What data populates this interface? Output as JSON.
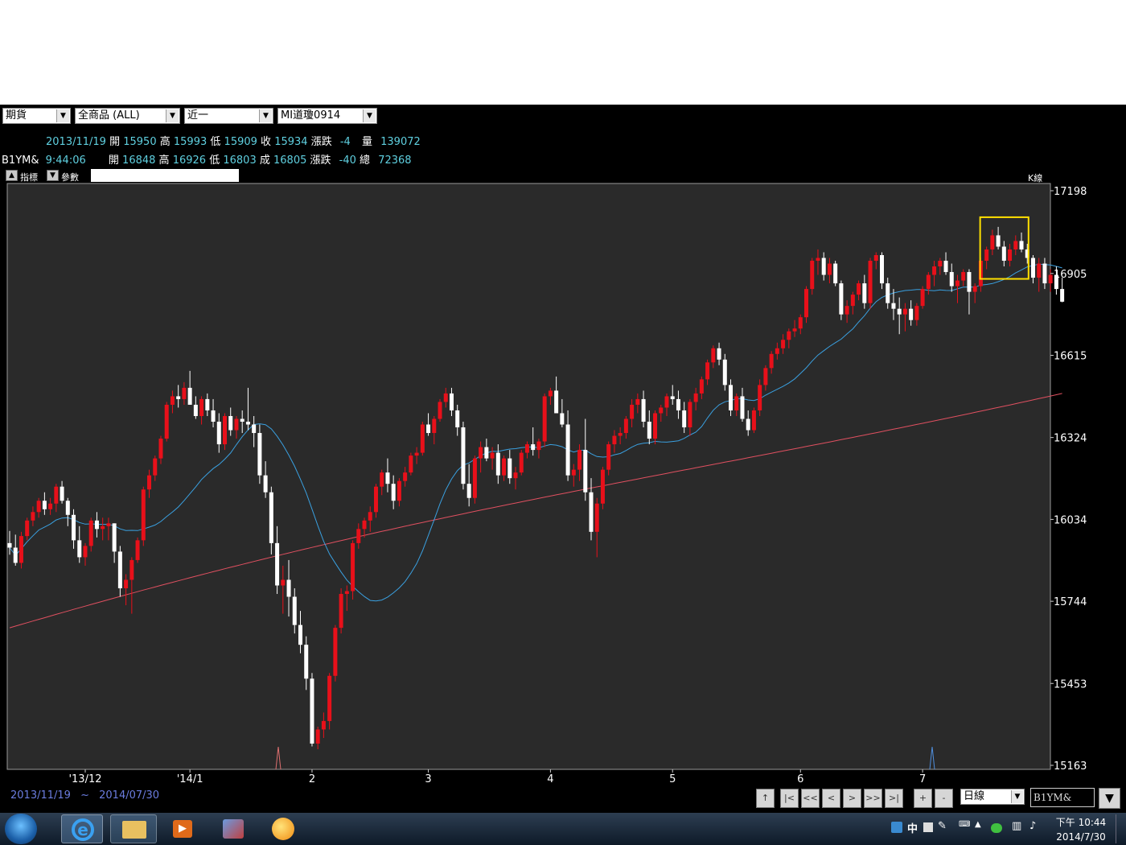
{
  "toolbar": {
    "market": "期貨",
    "product": "全商品        (ALL)",
    "period_sel": "近一",
    "symbol_sel": "MI道瓊0914"
  },
  "quote1": {
    "date": "2013/11/19",
    "open_lbl": "開",
    "open": "15950",
    "high_lbl": "高",
    "high": "15993",
    "low_lbl": "低",
    "low": "15909",
    "close_lbl": "收",
    "close": "15934",
    "chg_lbl": "漲跌",
    "chg": "-4",
    "vol_lbl": "量",
    "vol": "139072"
  },
  "quote2": {
    "sym": "B1YM&",
    "time": "9:44:06",
    "open_lbl": "開",
    "open": "16848",
    "high_lbl": "高",
    "high": "16926",
    "low_lbl": "低",
    "low": "16803",
    "last_lbl": "成",
    "last": "16805",
    "chg_lbl": "漲跌",
    "chg": "-40",
    "tot_lbl": "總",
    "tot": "72368"
  },
  "panel": {
    "indicator": "指標",
    "params": "參數",
    "klabel": "K線"
  },
  "bottom": {
    "range_start": "2013/11/19",
    "range_sep": "~",
    "range_end": "2014/07/30",
    "period": "日線",
    "symbol": "B1YM&"
  },
  "nav": [
    "↑",
    "|<",
    "<<",
    "<",
    ">",
    ">>",
    ">|",
    "+",
    "-"
  ],
  "clock": {
    "time": "下午 10:44",
    "date": "2014/7/30"
  },
  "tray": {
    "ime": "中"
  },
  "colors": {
    "up": "#e8101a",
    "down": "#ffffff",
    "ma_short": "#3aa0e0",
    "ma_long": "#e05060",
    "highlight": "#ffe000",
    "plot_bg": "#2a2a2a"
  },
  "chart_data": {
    "type": "candlestick",
    "ylim": [
      15163,
      17198
    ],
    "yticks": [
      17198,
      16905,
      16615,
      16324,
      16034,
      15744,
      15453,
      15163
    ],
    "xtick_labels": [
      "'13/12",
      "'14/1",
      "2",
      "3",
      "4",
      "5",
      "6",
      "7"
    ],
    "xtick_index": [
      13,
      31,
      52,
      72,
      93,
      114,
      136,
      157
    ],
    "candles": [
      [
        15950,
        15993,
        15909,
        15934
      ],
      [
        15934,
        15980,
        15870,
        15880
      ],
      [
        15880,
        15990,
        15860,
        15975
      ],
      [
        15975,
        16040,
        15960,
        16030
      ],
      [
        16030,
        16080,
        16010,
        16060
      ],
      [
        16060,
        16110,
        16040,
        16100
      ],
      [
        16100,
        16130,
        16050,
        16070
      ],
      [
        16070,
        16110,
        16050,
        16090
      ],
      [
        16090,
        16160,
        16060,
        16150
      ],
      [
        16150,
        16170,
        16090,
        16100
      ],
      [
        16100,
        16110,
        16010,
        16050
      ],
      [
        16050,
        16070,
        15930,
        15960
      ],
      [
        15960,
        16010,
        15880,
        15900
      ],
      [
        15900,
        15950,
        15870,
        15940
      ],
      [
        15940,
        16040,
        15920,
        16030
      ],
      [
        16030,
        16060,
        15970,
        16000
      ],
      [
        16000,
        16040,
        15960,
        16010
      ],
      [
        16010,
        16040,
        15960,
        16020
      ],
      [
        16020,
        16020,
        15880,
        15920
      ],
      [
        15920,
        15940,
        15760,
        15790
      ],
      [
        15790,
        15840,
        15730,
        15820
      ],
      [
        15820,
        15900,
        15700,
        15890
      ],
      [
        15890,
        15970,
        15880,
        15960
      ],
      [
        15960,
        16150,
        15940,
        16140
      ],
      [
        16140,
        16210,
        16110,
        16190
      ],
      [
        16190,
        16260,
        16170,
        16250
      ],
      [
        16250,
        16330,
        16230,
        16320
      ],
      [
        16320,
        16450,
        16310,
        16440
      ],
      [
        16440,
        16490,
        16410,
        16470
      ],
      [
        16470,
        16510,
        16430,
        16460
      ],
      [
        16460,
        16520,
        16440,
        16500
      ],
      [
        16500,
        16560,
        16460,
        16440
      ],
      [
        16440,
        16470,
        16390,
        16400
      ],
      [
        16400,
        16470,
        16370,
        16460
      ],
      [
        16460,
        16480,
        16400,
        16420
      ],
      [
        16420,
        16460,
        16360,
        16380
      ],
      [
        16380,
        16410,
        16270,
        16300
      ],
      [
        16300,
        16410,
        16280,
        16400
      ],
      [
        16400,
        16430,
        16330,
        16350
      ],
      [
        16350,
        16400,
        16320,
        16390
      ],
      [
        16390,
        16420,
        16340,
        16380
      ],
      [
        16380,
        16500,
        16350,
        16370
      ],
      [
        16370,
        16400,
        16290,
        16340
      ],
      [
        16340,
        16370,
        16160,
        16190
      ],
      [
        16190,
        16240,
        16110,
        16130
      ],
      [
        16130,
        16150,
        15910,
        15950
      ],
      [
        15950,
        16010,
        15770,
        15800
      ],
      [
        15800,
        15870,
        15700,
        15820
      ],
      [
        15820,
        15890,
        15690,
        15760
      ],
      [
        15760,
        15790,
        15630,
        15660
      ],
      [
        15660,
        15710,
        15560,
        15590
      ],
      [
        15590,
        15620,
        15430,
        15470
      ],
      [
        15470,
        15490,
        15230,
        15240
      ],
      [
        15240,
        15300,
        15220,
        15290
      ],
      [
        15290,
        15350,
        15260,
        15320
      ],
      [
        15320,
        15490,
        15290,
        15480
      ],
      [
        15480,
        15660,
        15460,
        15650
      ],
      [
        15650,
        15790,
        15630,
        15770
      ],
      [
        15770,
        15800,
        15710,
        15780
      ],
      [
        15780,
        15960,
        15750,
        15950
      ],
      [
        15950,
        16020,
        15930,
        16000
      ],
      [
        16000,
        16040,
        15970,
        16030
      ],
      [
        16030,
        16080,
        15990,
        16060
      ],
      [
        16060,
        16160,
        16040,
        16150
      ],
      [
        16150,
        16210,
        16120,
        16200
      ],
      [
        16200,
        16250,
        16130,
        16160
      ],
      [
        16160,
        16190,
        16070,
        16100
      ],
      [
        16100,
        16180,
        16080,
        16170
      ],
      [
        16170,
        16220,
        16150,
        16200
      ],
      [
        16200,
        16270,
        16190,
        16260
      ],
      [
        16260,
        16290,
        16230,
        16270
      ],
      [
        16270,
        16380,
        16260,
        16370
      ],
      [
        16370,
        16410,
        16330,
        16340
      ],
      [
        16340,
        16400,
        16300,
        16390
      ],
      [
        16390,
        16460,
        16380,
        16450
      ],
      [
        16450,
        16500,
        16430,
        16480
      ],
      [
        16480,
        16500,
        16400,
        16420
      ],
      [
        16420,
        16440,
        16330,
        16360
      ],
      [
        16360,
        16380,
        16140,
        16160
      ],
      [
        16160,
        16230,
        16080,
        16110
      ],
      [
        16110,
        16260,
        16090,
        16250
      ],
      [
        16250,
        16310,
        16200,
        16290
      ],
      [
        16290,
        16320,
        16240,
        16250
      ],
      [
        16250,
        16290,
        16210,
        16270
      ],
      [
        16270,
        16300,
        16160,
        16190
      ],
      [
        16190,
        16260,
        16170,
        16250
      ],
      [
        16250,
        16280,
        16160,
        16180
      ],
      [
        16180,
        16220,
        16140,
        16200
      ],
      [
        16200,
        16280,
        16190,
        16270
      ],
      [
        16270,
        16310,
        16250,
        16300
      ],
      [
        16300,
        16360,
        16260,
        16280
      ],
      [
        16280,
        16320,
        16250,
        16310
      ],
      [
        16310,
        16480,
        16290,
        16470
      ],
      [
        16470,
        16500,
        16440,
        16490
      ],
      [
        16490,
        16540,
        16450,
        16410
      ],
      [
        16410,
        16460,
        16360,
        16370
      ],
      [
        16370,
        16420,
        16170,
        16190
      ],
      [
        16190,
        16230,
        16150,
        16210
      ],
      [
        16210,
        16300,
        16170,
        16280
      ],
      [
        16280,
        16390,
        16100,
        16130
      ],
      [
        16130,
        16180,
        15960,
        15990
      ],
      [
        15990,
        16110,
        15900,
        16090
      ],
      [
        16090,
        16220,
        16070,
        16210
      ],
      [
        16210,
        16310,
        16190,
        16300
      ],
      [
        16300,
        16350,
        16270,
        16330
      ],
      [
        16330,
        16360,
        16300,
        16340
      ],
      [
        16340,
        16400,
        16320,
        16390
      ],
      [
        16390,
        16460,
        16360,
        16440
      ],
      [
        16440,
        16480,
        16410,
        16460
      ],
      [
        16460,
        16490,
        16360,
        16380
      ],
      [
        16380,
        16420,
        16300,
        16320
      ],
      [
        16320,
        16420,
        16300,
        16410
      ],
      [
        16410,
        16440,
        16380,
        16430
      ],
      [
        16430,
        16480,
        16400,
        16470
      ],
      [
        16470,
        16510,
        16440,
        16460
      ],
      [
        16460,
        16490,
        16390,
        16420
      ],
      [
        16420,
        16450,
        16340,
        16360
      ],
      [
        16360,
        16460,
        16330,
        16450
      ],
      [
        16450,
        16500,
        16420,
        16480
      ],
      [
        16480,
        16540,
        16460,
        16530
      ],
      [
        16530,
        16600,
        16510,
        16590
      ],
      [
        16590,
        16650,
        16570,
        16640
      ],
      [
        16640,
        16660,
        16580,
        16600
      ],
      [
        16600,
        16620,
        16490,
        16510
      ],
      [
        16510,
        16530,
        16400,
        16420
      ],
      [
        16420,
        16480,
        16400,
        16470
      ],
      [
        16470,
        16500,
        16380,
        16390
      ],
      [
        16390,
        16420,
        16330,
        16350
      ],
      [
        16350,
        16430,
        16340,
        16420
      ],
      [
        16420,
        16530,
        16400,
        16510
      ],
      [
        16510,
        16580,
        16490,
        16570
      ],
      [
        16570,
        16630,
        16550,
        16620
      ],
      [
        16620,
        16660,
        16600,
        16640
      ],
      [
        16640,
        16690,
        16620,
        16670
      ],
      [
        16670,
        16710,
        16640,
        16700
      ],
      [
        16700,
        16740,
        16680,
        16710
      ],
      [
        16710,
        16760,
        16690,
        16750
      ],
      [
        16750,
        16860,
        16730,
        16850
      ],
      [
        16850,
        16960,
        16830,
        16950
      ],
      [
        16950,
        16990,
        16900,
        16960
      ],
      [
        16960,
        16980,
        16880,
        16900
      ],
      [
        16900,
        16960,
        16870,
        16940
      ],
      [
        16940,
        16950,
        16860,
        16870
      ],
      [
        16870,
        16880,
        16740,
        16760
      ],
      [
        16760,
        16810,
        16730,
        16790
      ],
      [
        16790,
        16840,
        16760,
        16830
      ],
      [
        16830,
        16880,
        16810,
        16870
      ],
      [
        16870,
        16900,
        16780,
        16800
      ],
      [
        16800,
        16960,
        16780,
        16950
      ],
      [
        16950,
        16980,
        16920,
        16970
      ],
      [
        16970,
        16980,
        16850,
        16870
      ],
      [
        16870,
        16890,
        16780,
        16800
      ],
      [
        16800,
        16850,
        16740,
        16780
      ],
      [
        16780,
        16820,
        16690,
        16760
      ],
      [
        16760,
        16800,
        16700,
        16780
      ],
      [
        16780,
        16810,
        16720,
        16740
      ],
      [
        16740,
        16800,
        16720,
        16790
      ],
      [
        16790,
        16860,
        16780,
        16850
      ],
      [
        16850,
        16910,
        16830,
        16900
      ],
      [
        16900,
        16950,
        16860,
        16930
      ],
      [
        16930,
        16960,
        16900,
        16950
      ],
      [
        16950,
        16980,
        16900,
        16910
      ],
      [
        16910,
        16940,
        16840,
        16860
      ],
      [
        16860,
        16900,
        16800,
        16880
      ],
      [
        16880,
        16920,
        16860,
        16910
      ],
      [
        16910,
        16920,
        16760,
        16840
      ],
      [
        16840,
        16870,
        16800,
        16860
      ],
      [
        16860,
        16960,
        16840,
        16950
      ],
      [
        16950,
        17000,
        16920,
        16990
      ],
      [
        16990,
        17060,
        16970,
        17040
      ],
      [
        17040,
        17070,
        16990,
        17000
      ],
      [
        17000,
        17020,
        16930,
        16950
      ],
      [
        16950,
        17010,
        16930,
        16990
      ],
      [
        16990,
        17040,
        16970,
        17020
      ],
      [
        17020,
        17050,
        16980,
        16990
      ],
      [
        16990,
        17010,
        16940,
        16960
      ],
      [
        16960,
        16970,
        16870,
        16890
      ],
      [
        16890,
        16960,
        16840,
        16940
      ],
      [
        16940,
        16960,
        16850,
        16870
      ],
      [
        16870,
        16920,
        16840,
        16900
      ],
      [
        16900,
        16930,
        16830,
        16850
      ],
      [
        16850,
        16890,
        16803,
        16805
      ]
    ],
    "ma_long": {
      "start": 15650,
      "end": 16480
    },
    "highlight_box": {
      "from_index": 168,
      "to_index": 173
    }
  }
}
